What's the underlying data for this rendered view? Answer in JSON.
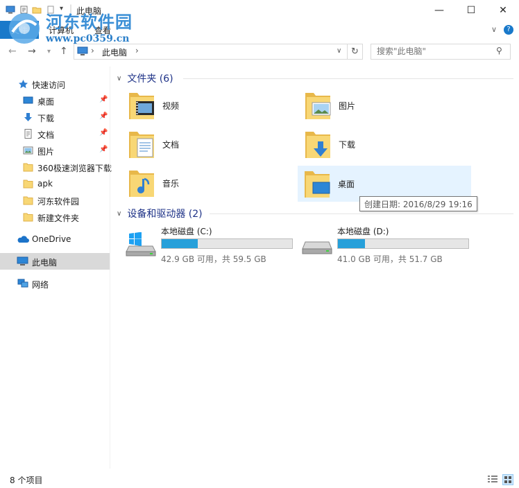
{
  "window": {
    "title": "此电脑",
    "controls": {
      "minimize": "—",
      "maximize": "☐",
      "close": "✕"
    }
  },
  "watermark": {
    "line1": "河东软件园",
    "line2": "www.pc0359.cn"
  },
  "ribbon": {
    "tabs": [
      {
        "label": "文件"
      },
      {
        "label": "计算机"
      },
      {
        "label": "查看"
      }
    ],
    "collapse": "∨",
    "help": "?"
  },
  "address": {
    "path": [
      "此电脑"
    ],
    "separator": "›",
    "search_placeholder": "搜索\"此电脑\""
  },
  "sidebar": {
    "quick_access": "快速访问",
    "quick_items": [
      {
        "label": "桌面",
        "icon": "desktop-icon",
        "pinned": true
      },
      {
        "label": "下载",
        "icon": "download-icon",
        "pinned": true
      },
      {
        "label": "文档",
        "icon": "document-icon",
        "pinned": true
      },
      {
        "label": "图片",
        "icon": "picture-icon",
        "pinned": true
      },
      {
        "label": "360极速浏览器下载",
        "icon": "folder-icon",
        "pinned": false
      },
      {
        "label": "apk",
        "icon": "folder-icon",
        "pinned": false
      },
      {
        "label": "河东软件园",
        "icon": "folder-icon",
        "pinned": false
      },
      {
        "label": "新建文件夹",
        "icon": "folder-icon",
        "pinned": false
      }
    ],
    "onedrive": "OneDrive",
    "this_pc": "此电脑",
    "network": "网络"
  },
  "content": {
    "folders_header": "文件夹 (6)",
    "folders": [
      {
        "label": "视频",
        "icon": "video-folder-icon"
      },
      {
        "label": "图片",
        "icon": "picture-folder-icon"
      },
      {
        "label": "文档",
        "icon": "document-folder-icon"
      },
      {
        "label": "下载",
        "icon": "download-folder-icon"
      },
      {
        "label": "音乐",
        "icon": "music-folder-icon"
      },
      {
        "label": "桌面",
        "icon": "desktop-folder-icon"
      }
    ],
    "drives_header": "设备和驱动器 (2)",
    "drives": [
      {
        "name": "本地磁盘 (C:)",
        "space": "42.9 GB 可用，共 59.5 GB",
        "used_fraction": 0.279,
        "icon": "windows-drive-icon"
      },
      {
        "name": "本地磁盘 (D:)",
        "space": "41.0 GB 可用，共 51.7 GB",
        "used_fraction": 0.207,
        "icon": "drive-icon"
      }
    ],
    "tooltip": "创建日期: 2016/8/29 19:16"
  },
  "status": {
    "items_count": "8 个项目"
  },
  "colors": {
    "accent": "#1979ca",
    "header_blue": "#1e3287",
    "drive_fill": "#26a0da",
    "selected_bg": "#cce8ff",
    "hover_bg": "#e5f3ff",
    "sidebar_selected": "#d9d9d9"
  }
}
